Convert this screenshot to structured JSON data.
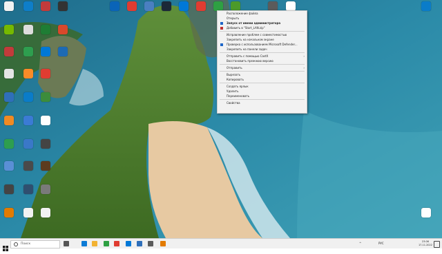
{
  "desktop": {
    "icons": [
      {
        "label": "",
        "color": "#3b7bd4"
      },
      {
        "label": "",
        "color": "#0e7ec9"
      },
      {
        "label": "",
        "color": "#c23b3b"
      },
      {
        "label": "",
        "color": "#333333"
      },
      {
        "label": "",
        "color": "#0a64b8"
      },
      {
        "label": "",
        "color": "#e03c31"
      },
      {
        "label": "",
        "color": "#4a7fc1"
      },
      {
        "label": "",
        "color": "#1b2838"
      },
      {
        "label": "",
        "color": "#0078d7"
      },
      {
        "label": "",
        "color": "#e03c31"
      },
      {
        "label": "",
        "color": "#2ea043"
      },
      {
        "label": "",
        "color": "#4c9a2a"
      },
      {
        "label": "",
        "color": "#5b5b5b"
      },
      {
        "label": "",
        "color": "#ffffff"
      },
      {
        "label": "",
        "color": "#76b900"
      },
      {
        "label": "",
        "color": "#dddddd"
      },
      {
        "label": "",
        "color": "#1e7d34"
      },
      {
        "label": "",
        "color": "#d9482b"
      },
      {
        "label": "",
        "color": "#c23b3b"
      },
      {
        "label": "",
        "color": "#2e9e4f"
      },
      {
        "label": "",
        "color": "#0078d7"
      },
      {
        "label": "",
        "color": "#1d6ab3"
      },
      {
        "label": "",
        "color": "#e5e5e5"
      },
      {
        "label": "",
        "color": "#fa8b28"
      },
      {
        "label": "",
        "color": "#e03c31"
      },
      {
        "label": "",
        "color": "#2f6fba"
      },
      {
        "label": "",
        "color": "#0a7cc9"
      },
      {
        "label": "",
        "color": "#3c8c3c"
      },
      {
        "label": "",
        "color": "#f08a24"
      },
      {
        "label": "",
        "color": "#3b7bd4"
      },
      {
        "label": "",
        "color": "#ffffff"
      },
      {
        "label": "",
        "color": "#2e9e4f"
      },
      {
        "label": "",
        "color": "#3a78c8"
      },
      {
        "label": "",
        "color": "#444444"
      },
      {
        "label": "",
        "color": "#5a8fd6"
      },
      {
        "label": "",
        "color": "#4a4a4a"
      },
      {
        "label": "",
        "color": "#5c3b1e"
      },
      {
        "label": "",
        "color": "#444444"
      },
      {
        "label": "",
        "color": "#2f4f6f"
      },
      {
        "label": "",
        "color": "#7a7a7a"
      },
      {
        "label": "",
        "color": "#e37b00"
      },
      {
        "label": "",
        "color": "#f2f2f2"
      },
      {
        "label": "",
        "color": "#f2f2f2"
      },
      {
        "label": "",
        "color": "#0a7cc9"
      },
      {
        "label": "",
        "color": "#ffffff"
      },
      {
        "label": "",
        "color": "#f2f2f2"
      }
    ]
  },
  "context_menu": {
    "items": [
      {
        "type": "item",
        "label": "Расположение файла"
      },
      {
        "type": "item",
        "label": "Открыть"
      },
      {
        "type": "item",
        "label": "Запуск от имени администратора",
        "bold": true,
        "icon": "shield-icon",
        "icon_color": "#1e66c8"
      },
      {
        "type": "item",
        "label": "Добавить в \"Start_LAN.zip\"",
        "icon": "archive-icon",
        "icon_color": "#c03030"
      },
      {
        "type": "sep"
      },
      {
        "type": "item",
        "label": "Исправление проблем с совместимостью"
      },
      {
        "type": "item",
        "label": "Закрепить на начальном экране"
      },
      {
        "type": "item",
        "label": "Проверка с использованием Microsoft Defender...",
        "icon": "defender-icon",
        "icon_color": "#1e66c8"
      },
      {
        "type": "item",
        "label": "Закрепить на панели задач"
      },
      {
        "type": "sep"
      },
      {
        "type": "item",
        "label": "Отправить с помощью CastX",
        "submenu": true
      },
      {
        "type": "item",
        "label": "Восстановить прежнюю версию"
      },
      {
        "type": "sep"
      },
      {
        "type": "item",
        "label": "Отправить",
        "submenu": true
      },
      {
        "type": "sep"
      },
      {
        "type": "item",
        "label": "Вырезать"
      },
      {
        "type": "item",
        "label": "Копировать"
      },
      {
        "type": "sep"
      },
      {
        "type": "item",
        "label": "Создать ярлык"
      },
      {
        "type": "item",
        "label": "Удалить"
      },
      {
        "type": "item",
        "label": "Переименовать"
      },
      {
        "type": "sep"
      },
      {
        "type": "item",
        "label": "Свойства"
      }
    ],
    "submenu_arrow": "›"
  },
  "taskbar": {
    "search_placeholder": "Поиск",
    "apps": [
      {
        "name": "task-view-icon",
        "color": "#555555"
      },
      {
        "name": "edge-icon",
        "color": "#0c7bd6"
      },
      {
        "name": "explorer-icon",
        "color": "#f2b233"
      },
      {
        "name": "chrome-icon",
        "color": "#2ea043"
      },
      {
        "name": "yandex-icon",
        "color": "#e03c31"
      },
      {
        "name": "store-icon",
        "color": "#0078d7"
      },
      {
        "name": "mail-icon",
        "color": "#2f6fba"
      },
      {
        "name": "app-icon",
        "color": "#5b5b5b"
      },
      {
        "name": "app-icon-2",
        "color": "#e37b00"
      }
    ],
    "tray_lang": "РУС",
    "time": "23:06",
    "date": "17.11.2022"
  }
}
